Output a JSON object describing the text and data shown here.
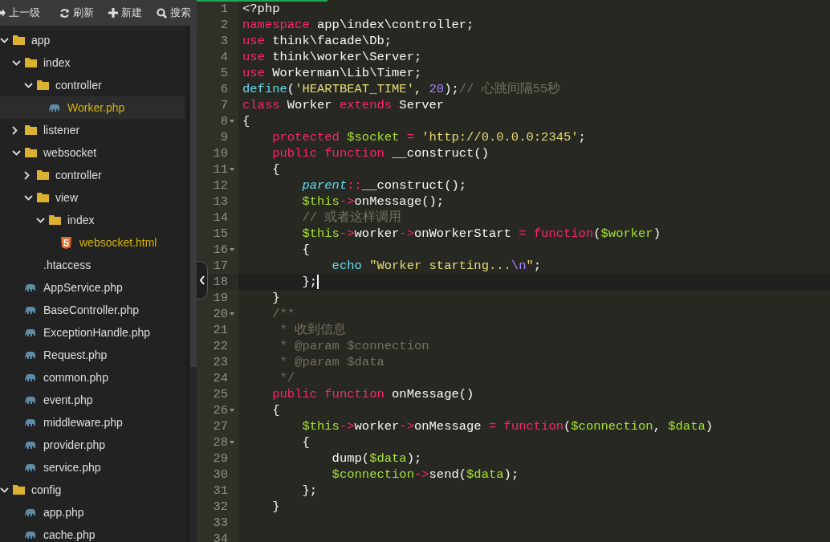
{
  "toolbar": [
    {
      "label": "上一级"
    },
    {
      "label": "刷新"
    },
    {
      "label": "新建"
    },
    {
      "label": "搜索"
    }
  ],
  "tree": [
    {
      "name": "app",
      "kind": "folder",
      "expanded": true,
      "children": [
        {
          "name": "index",
          "kind": "folder",
          "expanded": true,
          "children": [
            {
              "name": "controller",
              "kind": "folder",
              "expanded": true,
              "children": [
                {
                  "name": "Worker.php",
                  "kind": "php",
                  "selected": true,
                  "open": true
                }
              ]
            }
          ]
        },
        {
          "name": "listener",
          "kind": "folder",
          "expanded": false
        },
        {
          "name": "websocket",
          "kind": "folder",
          "expanded": true,
          "children": [
            {
              "name": "controller",
              "kind": "folder",
              "expanded": false
            },
            {
              "name": "view",
              "kind": "folder",
              "expanded": true,
              "children": [
                {
                  "name": "index",
                  "kind": "folder",
                  "expanded": true,
                  "children": [
                    {
                      "name": "websocket.html",
                      "kind": "html",
                      "selected": false,
                      "open": true
                    }
                  ]
                }
              ]
            }
          ]
        },
        {
          "name": ".htaccess",
          "kind": "other",
          "selected": false,
          "open": false
        },
        {
          "name": "AppService.php",
          "kind": "php",
          "selected": false,
          "open": false
        },
        {
          "name": "BaseController.php",
          "kind": "php",
          "selected": false,
          "open": false
        },
        {
          "name": "ExceptionHandle.php",
          "kind": "php",
          "selected": false,
          "open": false
        },
        {
          "name": "Request.php",
          "kind": "php",
          "selected": false,
          "open": false
        },
        {
          "name": "common.php",
          "kind": "php",
          "selected": false,
          "open": false
        },
        {
          "name": "event.php",
          "kind": "php",
          "selected": false,
          "open": false
        },
        {
          "name": "middleware.php",
          "kind": "php",
          "selected": false,
          "open": false
        },
        {
          "name": "provider.php",
          "kind": "php",
          "selected": false,
          "open": false
        },
        {
          "name": "service.php",
          "kind": "php",
          "selected": false,
          "open": false
        }
      ]
    },
    {
      "name": "config",
      "kind": "folder",
      "expanded": true,
      "children": [
        {
          "name": "app.php",
          "kind": "php",
          "selected": false,
          "open": false
        },
        {
          "name": "cache.php",
          "kind": "php",
          "selected": false,
          "open": false
        }
      ]
    }
  ],
  "code": [
    {
      "number": "1",
      "tokens": [
        {
          "text": "<?php",
          "kind": "plain"
        }
      ]
    },
    {
      "number": "2",
      "tokens": [
        {
          "text": "namespace",
          "kind": "keyword"
        },
        {
          "text": " app\\index\\controller;",
          "kind": "plain"
        }
      ]
    },
    {
      "number": "3",
      "tokens": [
        {
          "text": "use",
          "kind": "keyword"
        },
        {
          "text": " think\\facade\\Db;",
          "kind": "plain"
        }
      ]
    },
    {
      "number": "4",
      "tokens": [
        {
          "text": "use",
          "kind": "keyword"
        },
        {
          "text": " think\\worker\\Server;",
          "kind": "plain"
        }
      ]
    },
    {
      "number": "5",
      "tokens": [
        {
          "text": "use",
          "kind": "keyword"
        },
        {
          "text": " Workerman\\Lib\\Timer;",
          "kind": "plain"
        }
      ]
    },
    {
      "number": "6",
      "tokens": [
        {
          "text": "define",
          "kind": "support"
        },
        {
          "text": "(",
          "kind": "plain"
        },
        {
          "text": "'HEARTBEAT_TIME'",
          "kind": "string"
        },
        {
          "text": ", ",
          "kind": "plain"
        },
        {
          "text": "20",
          "kind": "number"
        },
        {
          "text": ");",
          "kind": "plain"
        },
        {
          "text": "// 心跳间隔55秒",
          "kind": "comment"
        }
      ]
    },
    {
      "number": "7",
      "tokens": [
        {
          "text": "class",
          "kind": "keyword"
        },
        {
          "text": " Worker ",
          "kind": "plain"
        },
        {
          "text": "extends",
          "kind": "keyword"
        },
        {
          "text": " Server",
          "kind": "plain"
        }
      ]
    },
    {
      "number": "8",
      "fold": true,
      "tokens": [
        {
          "text": "{",
          "kind": "plain"
        }
      ]
    },
    {
      "number": "9",
      "tokens": [
        {
          "text": "    protected",
          "kind": "keyword"
        },
        {
          "text": " $socket",
          "kind": "variable"
        },
        {
          "text": " =",
          "kind": "keyword"
        },
        {
          "text": " 'http://0.0.0.0:2345'",
          "kind": "string"
        },
        {
          "text": ";",
          "kind": "plain"
        }
      ]
    },
    {
      "number": "10",
      "tokens": [
        {
          "text": "    public",
          "kind": "keyword"
        },
        {
          "text": " function",
          "kind": "keyword"
        },
        {
          "text": " __construct()",
          "kind": "plain"
        }
      ]
    },
    {
      "number": "11",
      "fold": true,
      "tokens": [
        {
          "text": "    {",
          "kind": "plain"
        }
      ]
    },
    {
      "number": "12",
      "tokens": [
        {
          "text": "        parent",
          "kind": "support-italic"
        },
        {
          "text": "::",
          "kind": "keyword"
        },
        {
          "text": "__construct();",
          "kind": "plain"
        }
      ]
    },
    {
      "number": "13",
      "tokens": [
        {
          "text": "        $this",
          "kind": "variable"
        },
        {
          "text": "->",
          "kind": "keyword"
        },
        {
          "text": "onMessage();",
          "kind": "plain"
        }
      ]
    },
    {
      "number": "14",
      "tokens": [
        {
          "text": "        // 或者这样调用",
          "kind": "comment"
        }
      ]
    },
    {
      "number": "15",
      "tokens": [
        {
          "text": "        $this",
          "kind": "variable"
        },
        {
          "text": "->",
          "kind": "keyword"
        },
        {
          "text": "worker",
          "kind": "plain"
        },
        {
          "text": "->",
          "kind": "keyword"
        },
        {
          "text": "onWorkerStart ",
          "kind": "plain"
        },
        {
          "text": "=",
          "kind": "keyword"
        },
        {
          "text": " function",
          "kind": "keyword"
        },
        {
          "text": "(",
          "kind": "plain"
        },
        {
          "text": "$worker",
          "kind": "variable"
        },
        {
          "text": ")",
          "kind": "plain"
        }
      ]
    },
    {
      "number": "16",
      "fold": true,
      "tokens": [
        {
          "text": "        {",
          "kind": "plain"
        }
      ]
    },
    {
      "number": "17",
      "tokens": [
        {
          "text": "            echo",
          "kind": "support"
        },
        {
          "text": " \"Worker starting...",
          "kind": "string"
        },
        {
          "text": "\\n",
          "kind": "number"
        },
        {
          "text": "\"",
          "kind": "string"
        },
        {
          "text": ";",
          "kind": "plain"
        }
      ]
    },
    {
      "number": "18",
      "active": true,
      "tokens": [
        {
          "text": "        };",
          "kind": "plain"
        }
      ]
    },
    {
      "number": "19",
      "tokens": [
        {
          "text": "    }",
          "kind": "plain"
        }
      ]
    },
    {
      "number": "20",
      "fold": true,
      "tokens": [
        {
          "text": "    /**",
          "kind": "comment"
        }
      ]
    },
    {
      "number": "21",
      "tokens": [
        {
          "text": "     * 收到信息",
          "kind": "comment"
        }
      ]
    },
    {
      "number": "22",
      "tokens": [
        {
          "text": "     * @param $connection",
          "kind": "comment"
        }
      ]
    },
    {
      "number": "23",
      "tokens": [
        {
          "text": "     * @param $data",
          "kind": "comment"
        }
      ]
    },
    {
      "number": "24",
      "tokens": [
        {
          "text": "     */",
          "kind": "comment"
        }
      ]
    },
    {
      "number": "25",
      "tokens": [
        {
          "text": "    public",
          "kind": "keyword"
        },
        {
          "text": " function",
          "kind": "keyword"
        },
        {
          "text": " onMessage()",
          "kind": "plain"
        }
      ]
    },
    {
      "number": "26",
      "fold": true,
      "tokens": [
        {
          "text": "    {",
          "kind": "plain"
        }
      ]
    },
    {
      "number": "27",
      "tokens": [
        {
          "text": "        $this",
          "kind": "variable"
        },
        {
          "text": "->",
          "kind": "keyword"
        },
        {
          "text": "worker",
          "kind": "plain"
        },
        {
          "text": "->",
          "kind": "keyword"
        },
        {
          "text": "onMessage ",
          "kind": "plain"
        },
        {
          "text": "=",
          "kind": "keyword"
        },
        {
          "text": " function",
          "kind": "keyword"
        },
        {
          "text": "(",
          "kind": "plain"
        },
        {
          "text": "$connection",
          "kind": "variable"
        },
        {
          "text": ", ",
          "kind": "plain"
        },
        {
          "text": "$data",
          "kind": "variable"
        },
        {
          "text": ")",
          "kind": "plain"
        }
      ]
    },
    {
      "number": "28",
      "fold": true,
      "tokens": [
        {
          "text": "        {",
          "kind": "plain"
        }
      ]
    },
    {
      "number": "29",
      "tokens": [
        {
          "text": "            dump(",
          "kind": "plain"
        },
        {
          "text": "$data",
          "kind": "variable"
        },
        {
          "text": ");",
          "kind": "plain"
        }
      ]
    },
    {
      "number": "30",
      "tokens": [
        {
          "text": "            $connection",
          "kind": "variable"
        },
        {
          "text": "->",
          "kind": "keyword"
        },
        {
          "text": "send(",
          "kind": "plain"
        },
        {
          "text": "$data",
          "kind": "variable"
        },
        {
          "text": ");",
          "kind": "plain"
        }
      ]
    },
    {
      "number": "31",
      "tokens": [
        {
          "text": "        };",
          "kind": "plain"
        }
      ]
    },
    {
      "number": "32",
      "tokens": [
        {
          "text": "    }",
          "kind": "plain"
        }
      ]
    },
    {
      "number": "33"
    },
    {
      "number": "34"
    }
  ]
}
